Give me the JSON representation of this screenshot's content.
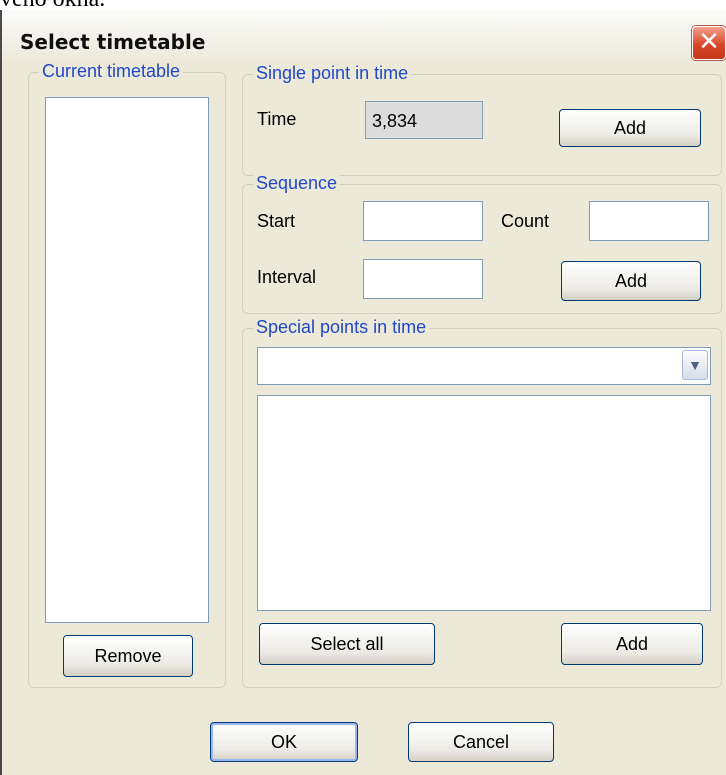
{
  "background_text": "vého okna.",
  "window": {
    "title": "Select timetable",
    "close_glyph": "✕"
  },
  "current_timetable": {
    "label": "Current timetable",
    "remove_label": "Remove"
  },
  "single_point": {
    "label": "Single point in time",
    "time_label": "Time",
    "time_value": "3,834",
    "add_label": "Add"
  },
  "sequence": {
    "label": "Sequence",
    "start_label": "Start",
    "start_value": "",
    "count_label": "Count",
    "count_value": "",
    "interval_label": "Interval",
    "interval_value": "",
    "add_label": "Add"
  },
  "special_points": {
    "label": "Special points in time",
    "selected_option": "",
    "select_all_label": "Select all",
    "add_label": "Add"
  },
  "footer": {
    "ok_label": "OK",
    "cancel_label": "Cancel"
  },
  "icons": {
    "close": "close-icon",
    "dropdown": "chevron-down-icon"
  },
  "colors": {
    "dialog_bg": "#ece9d8",
    "group_title": "#2148c8",
    "close_button": "#d9472a",
    "input_border": "#7f9db9"
  }
}
